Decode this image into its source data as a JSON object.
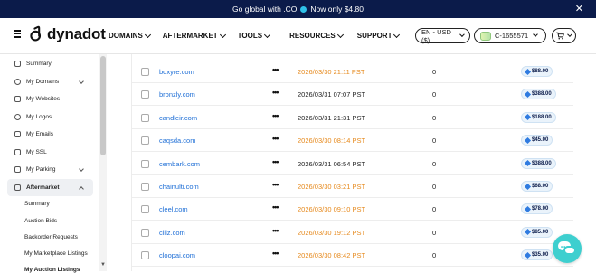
{
  "promo": {
    "text_before": "Go global with .CO",
    "text_after": "Now only $4.80",
    "close": "✕"
  },
  "header": {
    "brand": "dynadot",
    "nav": [
      "DOMAINS",
      "AFTERMARKET",
      "TOOLS",
      "RESOURCES",
      "SUPPORT"
    ],
    "language": "EN - USD ($)",
    "account": "C-1655571"
  },
  "sidebar": {
    "items": [
      {
        "label": "Summary",
        "icon": "home-icon"
      },
      {
        "label": "My Domains",
        "icon": "globe-icon"
      },
      {
        "label": "My Websites",
        "icon": "brush-icon"
      },
      {
        "label": "My Logos",
        "icon": "logo-icon"
      },
      {
        "label": "My Emails",
        "icon": "mail-icon"
      },
      {
        "label": "My SSL",
        "icon": "lock-icon"
      },
      {
        "label": "My Parking",
        "icon": "parking-icon"
      },
      {
        "label": "Aftermarket",
        "icon": "tag-icon"
      }
    ],
    "sub_items": [
      "Summary",
      "Auction Bids",
      "Backorder Requests",
      "My Marketplace Listings",
      "My Auction Listings"
    ]
  },
  "table": {
    "rows": [
      {
        "domain": "boxyre.com",
        "date": "2026/03/30 21:11 PST",
        "date_color": "orange",
        "bids": "0",
        "price": "$88.00"
      },
      {
        "domain": "bronzly.com",
        "date": "2026/03/31 07:07 PST",
        "date_color": "black",
        "bids": "0",
        "price": "$388.00"
      },
      {
        "domain": "candleir.com",
        "date": "2026/03/31 21:31 PST",
        "date_color": "black",
        "bids": "0",
        "price": "$188.00"
      },
      {
        "domain": "caqsda.com",
        "date": "2026/03/30 08:14 PST",
        "date_color": "orange",
        "bids": "0",
        "price": "$45.00"
      },
      {
        "domain": "cembark.com",
        "date": "2026/03/31 06:54 PST",
        "date_color": "black",
        "bids": "0",
        "price": "$388.00"
      },
      {
        "domain": "chainulti.com",
        "date": "2026/03/30 03:21 PST",
        "date_color": "orange",
        "bids": "0",
        "price": "$68.00"
      },
      {
        "domain": "cleel.com",
        "date": "2026/03/30 09:10 PST",
        "date_color": "orange",
        "bids": "0",
        "price": "$78.00"
      },
      {
        "domain": "cliiz.com",
        "date": "2026/03/30 19:12 PST",
        "date_color": "orange",
        "bids": "0",
        "price": "$85.00"
      },
      {
        "domain": "cloopai.com",
        "date": "2026/03/30 08:42 PST",
        "date_color": "orange",
        "bids": "0",
        "price": "$35.00"
      }
    ]
  },
  "colors": {
    "promo_bg": "#0b1b4a",
    "link": "#1f6fd6",
    "orange": "#e6891c",
    "chat": "#3ecfcf"
  }
}
